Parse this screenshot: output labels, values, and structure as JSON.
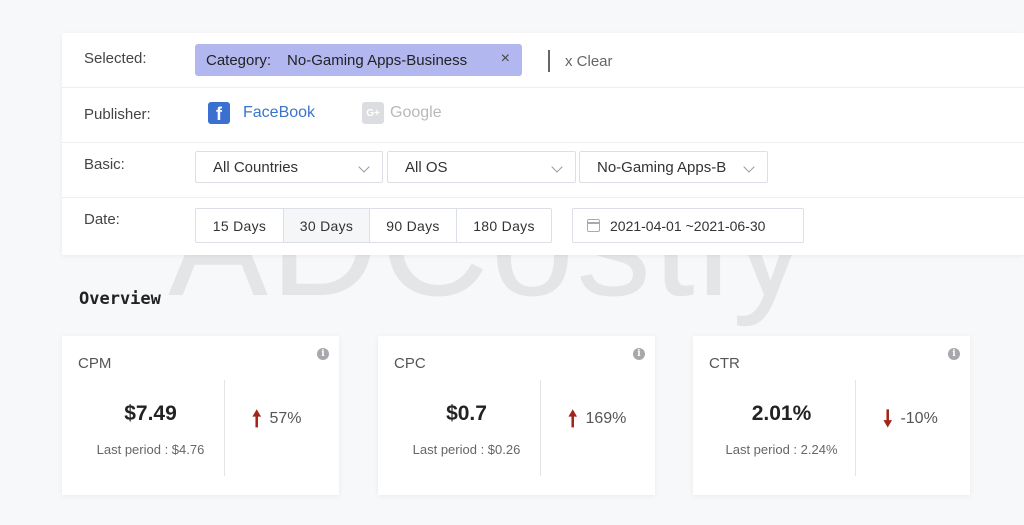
{
  "filters": {
    "selected_label": "Selected:",
    "chip": {
      "key": "Category:",
      "value": "No-Gaming Apps-Business",
      "close_glyph": "×"
    },
    "clear_label": "x Clear",
    "publisher_label": "Publisher:",
    "publishers": [
      {
        "name": "FaceBook",
        "icon": "facebook-icon",
        "glyph": "f",
        "active": true
      },
      {
        "name": "Google",
        "icon": "google-plus-icon",
        "glyph": "G+",
        "active": false
      }
    ],
    "basic_label": "Basic:",
    "selects": [
      {
        "value": "All Countries"
      },
      {
        "value": "All OS"
      },
      {
        "value": "No-Gaming Apps-B"
      }
    ],
    "date_label": "Date:",
    "ranges": [
      "15 Days",
      "30 Days",
      "90 Days",
      "180 Days"
    ],
    "active_range": "30 Days",
    "date_start": "2021-04-01",
    "date_end": "~2021-06-30"
  },
  "watermark": "ADCostly",
  "overview": {
    "title": "Overview",
    "cards": [
      {
        "name": "CPM",
        "value": "$7.49",
        "prev": "Last period : $4.76",
        "direction": "up",
        "change": "57%"
      },
      {
        "name": "CPC",
        "value": "$0.7",
        "prev": "Last period : $0.26",
        "direction": "up",
        "change": "169%"
      },
      {
        "name": "CTR",
        "value": "2.01%",
        "prev": "Last period : 2.24%",
        "direction": "down",
        "change": "-10%"
      }
    ],
    "colors": {
      "arrow": "#a32519",
      "chip": "#b3b7f0",
      "facebook": "#3b6fd0"
    }
  }
}
